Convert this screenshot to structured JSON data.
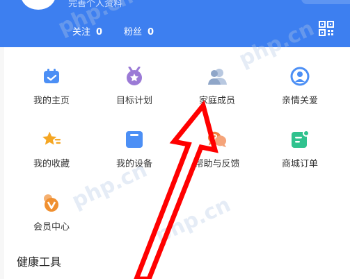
{
  "header": {
    "subtitle": "完善个人资料",
    "stats": [
      {
        "label": "关注",
        "value": "0"
      },
      {
        "label": "粉丝",
        "value": "0"
      }
    ],
    "qr_icon": "qr-code-icon"
  },
  "grid": {
    "items": [
      {
        "label": "我的主页",
        "icon": "calendar-icon",
        "color": "#4c8ff5"
      },
      {
        "label": "目标计划",
        "icon": "star-medal-icon",
        "color": "#9b7ad6"
      },
      {
        "label": "家庭成员",
        "icon": "family-icon",
        "color": "#9ab0d0"
      },
      {
        "label": "亲情关爱",
        "icon": "care-icon",
        "color": "#4c8ff5"
      },
      {
        "label": "我的收藏",
        "icon": "star-icon",
        "color": "#f5a623"
      },
      {
        "label": "我的设备",
        "icon": "device-icon",
        "color": "#4c8ff5"
      },
      {
        "label": "帮助与反馈",
        "icon": "chat-help-icon",
        "color": "#f08040"
      },
      {
        "label": "商城订单",
        "icon": "order-icon",
        "color": "#2fc28e"
      },
      {
        "label": "会员中心",
        "icon": "vip-icon",
        "color": "#f09030"
      }
    ]
  },
  "section": {
    "title": "健康工具"
  },
  "watermarks": [
    "php.cn",
    "php.cn",
    "php.cn",
    "php.cn"
  ]
}
